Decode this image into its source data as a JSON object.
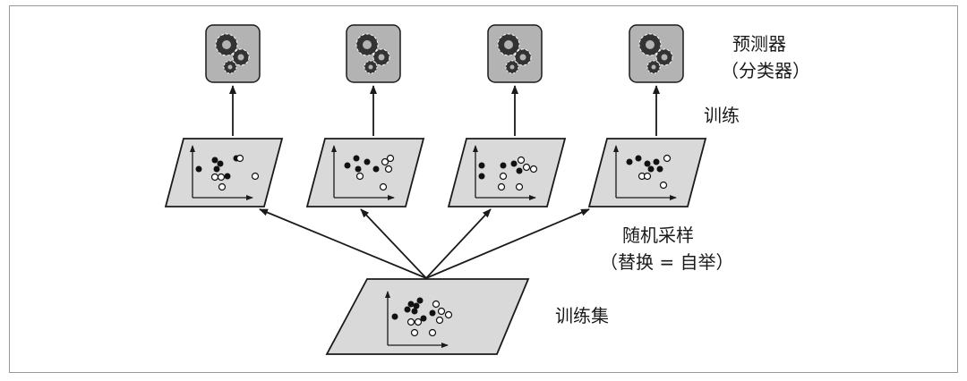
{
  "labels": {
    "predictor": "预测器",
    "classifier": "（分类器）",
    "train": "训练",
    "sampling": "随机采样",
    "replacement": "（替换 = 自举）",
    "training_set": "训练集"
  },
  "colors": {
    "panel_fill": "#d9d9d9",
    "predictor_fill": "#b3b3b3",
    "stroke": "#1a1a1a"
  },
  "icons": [
    "gears-icon"
  ],
  "predictor_count": 4,
  "subset_count": 4
}
